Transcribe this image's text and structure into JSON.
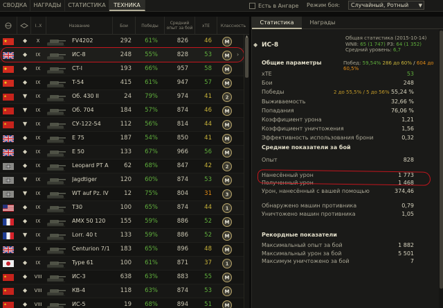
{
  "tabs": [
    {
      "label": "СВОДКА"
    },
    {
      "label": "НАГРАДЫ"
    },
    {
      "label": "СТАТИСТИКА"
    },
    {
      "label": "ТЕХНИКА"
    }
  ],
  "filter": {
    "hangar_label": "Есть в Ангаре",
    "mode_label": "Режим боя:",
    "mode_value": "Случайный, Ротный"
  },
  "table": {
    "col_tier": "I..X",
    "col_name": "Название",
    "col_battles": "Бои",
    "col_wins": "Победы",
    "col_xp": "Средний опыт за бой",
    "col_xte": "xTE",
    "col_mastery": "Классность"
  },
  "colors": {
    "green": "#5fae3c",
    "yellow": "#c9b43a",
    "orange": "#e08a16",
    "red": "#d62d26",
    "annotation": "#c3151d"
  },
  "vehicles": [
    {
      "flag": "china",
      "type": "heavy",
      "tier": "X",
      "name": "FV4202",
      "battles": "292",
      "wins": "61%",
      "wins_color": "green",
      "xp": "826",
      "xte": "46",
      "xte_color": "yellow",
      "mastery": "M"
    },
    {
      "flag": "uk",
      "type": "heavy",
      "tier": "IX",
      "name": "ИС-8",
      "battles": "248",
      "wins": "55%",
      "wins_color": "green",
      "xp": "828",
      "xte": "53",
      "xte_color": "green",
      "mastery": "M"
    },
    {
      "flag": "china",
      "type": "heavy",
      "tier": "IX",
      "name": "CT-I",
      "battles": "193",
      "wins": "66%",
      "wins_color": "green",
      "xp": "957",
      "xte": "58",
      "xte_color": "green",
      "mastery": "M"
    },
    {
      "flag": "china",
      "type": "heavy",
      "tier": "IX",
      "name": "T-54",
      "battles": "415",
      "wins": "61%",
      "wins_color": "green",
      "xp": "947",
      "xte": "57",
      "xte_color": "green",
      "mastery": "M"
    },
    {
      "flag": "ussr",
      "type": "td",
      "tier": "IX",
      "name": "Об. 430 II",
      "battles": "24",
      "wins": "79%",
      "wins_color": "green",
      "xp": "974",
      "xte": "41",
      "xte_color": "yellow",
      "mastery": "2"
    },
    {
      "flag": "ussr",
      "type": "td",
      "tier": "IX",
      "name": "Об. 704",
      "battles": "184",
      "wins": "57%",
      "wins_color": "green",
      "xp": "874",
      "xte": "46",
      "xte_color": "yellow",
      "mastery": "M"
    },
    {
      "flag": "ussr",
      "type": "td",
      "tier": "IX",
      "name": "СУ-122-54",
      "battles": "112",
      "wins": "56%",
      "wins_color": "green",
      "xp": "814",
      "xte": "44",
      "xte_color": "yellow",
      "mastery": "M"
    },
    {
      "flag": "uk",
      "type": "heavy",
      "tier": "IX",
      "name": "E 75",
      "battles": "187",
      "wins": "54%",
      "wins_color": "green",
      "xp": "850",
      "xte": "41",
      "xte_color": "yellow",
      "mastery": "M"
    },
    {
      "flag": "uk",
      "type": "heavy",
      "tier": "IX",
      "name": "E 50",
      "battles": "133",
      "wins": "67%",
      "wins_color": "green",
      "xp": "966",
      "xte": "56",
      "xte_color": "green",
      "mastery": "M"
    },
    {
      "flag": "germany",
      "type": "medium",
      "tier": "IX",
      "name": "Leopard PT A",
      "battles": "62",
      "wins": "68%",
      "wins_color": "green",
      "xp": "847",
      "xte": "42",
      "xte_color": "yellow",
      "mastery": "2"
    },
    {
      "flag": "germany",
      "type": "td",
      "tier": "IX",
      "name": "Jagdtiger",
      "battles": "120",
      "wins": "60%",
      "wins_color": "green",
      "xp": "874",
      "xte": "53",
      "xte_color": "green",
      "mastery": "M"
    },
    {
      "flag": "germany",
      "type": "td",
      "tier": "IX",
      "name": "WT auf Pz. IV",
      "battles": "12",
      "wins": "75%",
      "wins_color": "green",
      "xp": "804",
      "xte": "31",
      "xte_color": "orange",
      "mastery": "3"
    },
    {
      "flag": "usa",
      "type": "heavy",
      "tier": "IX",
      "name": "T30",
      "battles": "100",
      "wins": "65%",
      "wins_color": "green",
      "xp": "874",
      "xte": "44",
      "xte_color": "yellow",
      "mastery": "1"
    },
    {
      "flag": "france",
      "type": "heavy",
      "tier": "IX",
      "name": "AMX 50 120",
      "battles": "155",
      "wins": "59%",
      "wins_color": "green",
      "xp": "886",
      "xte": "52",
      "xte_color": "green",
      "mastery": "M"
    },
    {
      "flag": "france",
      "type": "td",
      "tier": "IX",
      "name": "Lorr. 40 t",
      "battles": "133",
      "wins": "59%",
      "wins_color": "green",
      "xp": "886",
      "xte": "52",
      "xte_color": "green",
      "mastery": "M"
    },
    {
      "flag": "uk",
      "type": "medium",
      "tier": "IX",
      "name": "Centurion 7/1",
      "battles": "183",
      "wins": "65%",
      "wins_color": "green",
      "xp": "896",
      "xte": "48",
      "xte_color": "yellow",
      "mastery": "M"
    },
    {
      "flag": "japan",
      "type": "medium",
      "tier": "IX",
      "name": "Type 61",
      "battles": "100",
      "wins": "61%",
      "wins_color": "green",
      "xp": "871",
      "xte": "37",
      "xte_color": "yellow",
      "mastery": "1"
    },
    {
      "flag": "ussr",
      "type": "heavy",
      "tier": "VIII",
      "name": "ИС-3",
      "battles": "638",
      "wins": "63%",
      "wins_color": "green",
      "xp": "883",
      "xte": "55",
      "xte_color": "green",
      "mastery": "M"
    },
    {
      "flag": "ussr",
      "type": "heavy",
      "tier": "VIII",
      "name": "КВ-4",
      "battles": "118",
      "wins": "63%",
      "wins_color": "green",
      "xp": "874",
      "xte": "53",
      "xte_color": "green",
      "mastery": "M"
    },
    {
      "flag": "ussr",
      "type": "heavy",
      "tier": "VIII",
      "name": "ИС-5",
      "battles": "19",
      "wins": "68%",
      "wins_color": "green",
      "xp": "894",
      "xte": "51",
      "xte_color": "green",
      "mastery": "M"
    }
  ],
  "panel": {
    "tab_stats": "Статистика",
    "tab_awards": "Награды",
    "title": "ИС-8",
    "general_title": "Общая статистика (2015-10-14)",
    "wn8_label": "WN8:",
    "wn8_value": "65 (1 747)",
    "rz_label": "РЗ:",
    "rz_value": "64 (1 352)",
    "avg_level_label": "Средний уровень:",
    "avg_level_value": "6,7",
    "main_header": "Общие параметры",
    "wins_summary_label": "Побед:",
    "wins_summary": [
      "59,54%",
      "286 до 60%",
      "604 до 60,5%"
    ],
    "stats": [
      {
        "label": "xTE",
        "value": "53",
        "color": "green"
      },
      {
        "label": "Бои",
        "value": "248"
      },
      {
        "label": "Победы",
        "sub": "2 до 55,5% / 5 до 56%",
        "value": "55,24 %"
      },
      {
        "label": "Выживаемость",
        "value": "32,66 %"
      },
      {
        "label": "Попадания",
        "value": "76,06 %"
      },
      {
        "label": "Коэффициент урона",
        "value": "1,21"
      },
      {
        "label": "Коэффициент уничтожения",
        "value": "1,56"
      },
      {
        "label": "Эффективность использования брони",
        "value": "0,32"
      }
    ],
    "avg_header": "Средние показатели за бой",
    "avg_stats": [
      {
        "label": "Опыт",
        "value": "828"
      },
      {
        "label": "Нанесённый урон",
        "value": "1 773"
      },
      {
        "label": "Полученный урон",
        "value": "1 468"
      },
      {
        "label": "Урон, нанесённый с вашей помощью",
        "value": "374,46"
      },
      {
        "label": "Обнаружено машин противника",
        "value": "0,79"
      },
      {
        "label": "Уничтожено машин противника",
        "value": "1,05"
      }
    ],
    "record_header": "Рекордные показатели",
    "record_stats": [
      {
        "label": "Максимальный опыт за бой",
        "value": "1 882"
      },
      {
        "label": "Максимальный урон за бой",
        "value": "5 501"
      },
      {
        "label": "Максимум уничтожено за бой",
        "value": "7"
      }
    ]
  }
}
